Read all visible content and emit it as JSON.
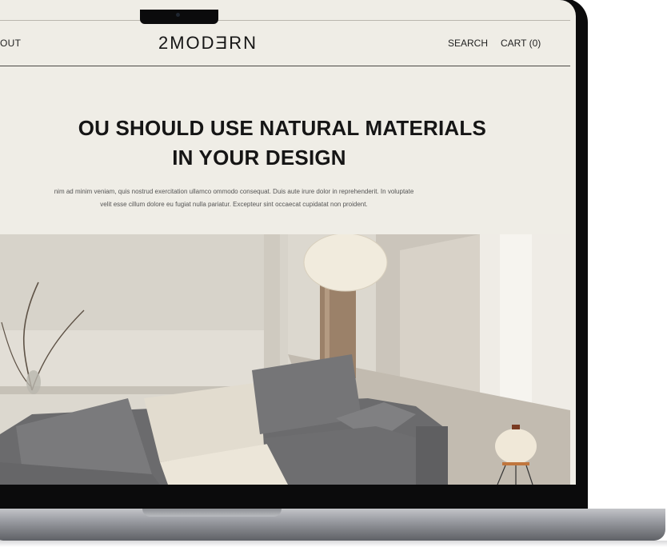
{
  "header": {
    "nav_left": "OUT",
    "logo": "2MODƎRN",
    "search_label": "SEARCH",
    "cart_label": "CART (0)"
  },
  "hero": {
    "headline_line1": "OU SHOULD USE NATURAL MATERIALS",
    "headline_line2": "IN YOUR DESIGN",
    "body_line1": "nim ad minim veniam, quis nostrud exercitation ullamco ommodo consequat. Duis aute irure dolor in reprehenderit. In voluptate",
    "body_line2": "velit esse cillum dolore eu fugiat nulla pariatur. Excepteur sint occaecat cupidatat non proident."
  },
  "colors": {
    "page_bg": "#efede6",
    "text": "#151515",
    "laptop_bezel": "#0b0b0c"
  },
  "icons": {
    "camera": "camera-icon"
  }
}
